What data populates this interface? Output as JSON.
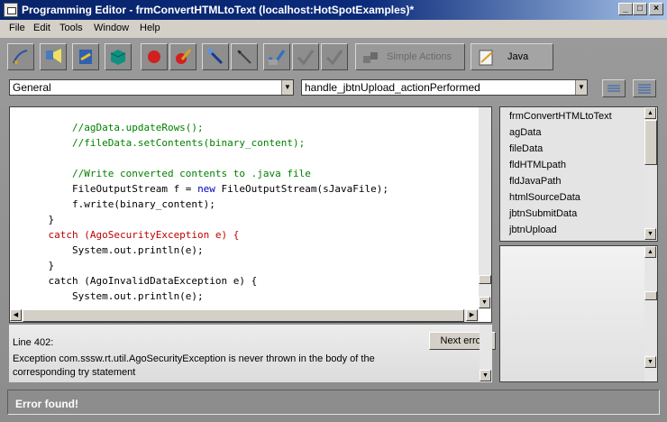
{
  "window": {
    "title": "Programming Editor - frmConvertHTMLtoText  (localhost:HotSpotExamples)*",
    "minimize": "_",
    "maximize": "□",
    "close": "×"
  },
  "menu": [
    "File",
    "Edit",
    "Tools",
    "Window",
    "Help"
  ],
  "toolbar": {
    "simple_actions_label": "Simple Actions",
    "java_label": "Java"
  },
  "selectors": {
    "object_value": "General",
    "method_value": "handle_jbtnUpload_actionPerformed"
  },
  "code_lines": [
    {
      "text": "        //agData.updateRows();",
      "kind": "comment"
    },
    {
      "text": "        //fileData.setContents(binary_content);",
      "kind": "comment"
    },
    {
      "text": "",
      "kind": "normal"
    },
    {
      "text": "        //Write converted contents to .java file",
      "kind": "comment"
    },
    {
      "text": "        FileOutputStream f = ",
      "kind": "normal",
      "kw": "new",
      "rest": " FileOutputStream(sJavaFile);"
    },
    {
      "text": "        f.write(binary_content);",
      "kind": "normal"
    },
    {
      "text": "    }",
      "kind": "normal"
    },
    {
      "text": "    catch (AgoSecurityException e) {",
      "kind": "error"
    },
    {
      "text": "        System.out.println(e);",
      "kind": "normal"
    },
    {
      "text": "    }",
      "kind": "normal"
    },
    {
      "text": "    catch (AgoInvalidDataException e) {",
      "kind": "normal"
    },
    {
      "text": "        System.out.println(e);",
      "kind": "normal"
    }
  ],
  "messages": {
    "line_label": "Line 402:",
    "next_error_label": "Next error",
    "error_text_1": "Exception com.sssw.rt.util.AgoSecurityException is never thrown in the body of the",
    "error_text_2": "corresponding try statement"
  },
  "member_list": [
    "frmConvertHTMLtoText",
    "agData",
    "fileData",
    "fldHTMLpath",
    "fldJavaPath",
    "htmlSourceData",
    "jbtnSubmitData",
    "jbtnUpload"
  ],
  "status_text": "Error found!",
  "colors": {
    "title_gradient_start": "#08246b",
    "comment": "#008000",
    "error_code": "#c00000",
    "keyword": "#0000c0"
  }
}
